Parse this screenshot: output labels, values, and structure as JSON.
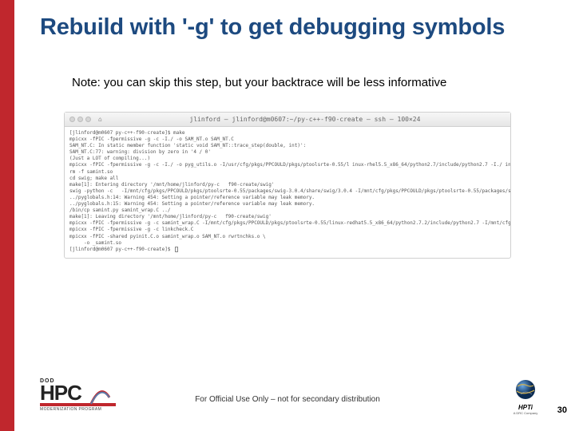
{
  "title": "Rebuild with '-g' to get debugging symbols",
  "note": "Note: you can skip this step, but your backtrace will be less informative",
  "terminal": {
    "window_title": "jlinford — jlinford@m0607:~/py-c++-f90-create — ssh — 100×24",
    "body": "[jlinford@m0607 py-c++-f90-create]$ make\nmpicxx -fPIC -fpermissive -g -c -I./ -o SAM_NT.o SAM_NT.C\nSAM_NT.C: In static member function 'static void SAM_NT::trace_step(double, int)':\nSAM_NT.C:77: warning: division by zero in '4 / 0'\n(Just a LOT of compiling...)\nmpicxx -fPIC -fpermissive -g -c -I./ -o pyg_utils.o -I/usr/cfg/pkgs/PPCOULD/pkgs/ptoolsrte-0.55/l inux-rhel5.5_x86_64/python2.7/include/python2.7 -I./ include/python2.7 pyg_utils.C\nrm -f samint.so\ncd swig; make all\nmake[1]: Entering directory '/mnt/home/jlinford/py-c   f90-create/swig'\nswig -python -c   -I/mnt/cfg/pkgs/PPCOULD/pkgs/ptoolsrte-0.55/packages/swig-3.0.4/share/swig/3.0.4 -I/mnt/cfg/pkgs/PPCOULD/pkgs/ptoolsrte-0.55/packages/swig-3.0.4/python -o samint_wrap.C ../samint.i\n../pyglobals.h:14: Warning 454: Setting a pointer/reference variable may leak memory.\n../pyglobals.h:15: Warning 454: Setting a pointer/reference variable may leak memory.\n/bin/cp samint.py samint_wrap.C ../\nmake[1]: Leaving directory '/mnt/home/jlinford/py-c   f90-create/swig'\nmpicxx -fPIC -fpermissive -g -c samint_wrap.C -I/mnt/cfg/pkgs/PPCOULD/pkgs/ptoolsrte-0.55/linux-redhat5.5_x86_64/python2.7.2/include/python2.7 -I/mnt/cfg/pkgs/PPCOULD/pkgs/ptoolsrte-0.55/linux-redhat5.5_x86_64/numpy-1.6.1/lib/python2.7/site-packages/numpy/include\nmpicxx -fPIC -fpermissive -g -c linkcheck.C\nmpicxx -fPIC -shared pyinit.C.o samint_wrap.o SAM_NT.o rwrtnchks.o \\\n     -o _samint.so\n[jlinford@m0607 py-c++-f90-create]$ "
  },
  "footer": "For Official Use Only – not for secondary distribution",
  "page": "30",
  "hpc_logo": {
    "dod": "DOD",
    "hpc": "HPC",
    "sub": "MODERNIZATION PROGRAM"
  },
  "hpti_logo": {
    "label": "HPTi",
    "tag": "A DRC Company"
  }
}
